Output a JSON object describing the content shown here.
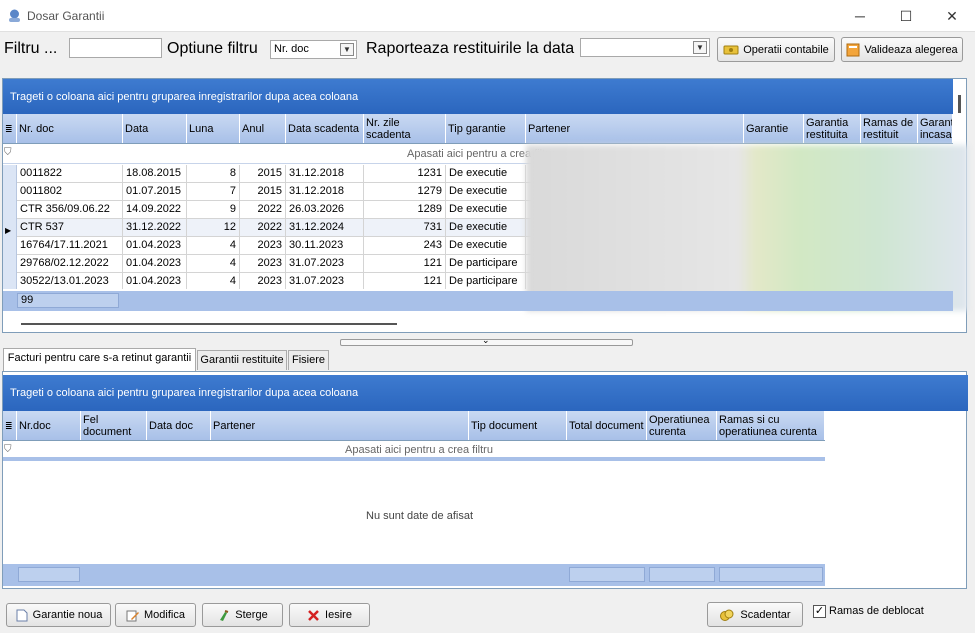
{
  "window": {
    "title": "Dosar Garantii",
    "min_glyph": "─",
    "max_glyph": "☐",
    "close_glyph": "✕"
  },
  "toolbar": {
    "filter_label": "Filtru ...",
    "filter_value": "",
    "option_label": "Optiune filtru",
    "option_value": "Nr. doc",
    "report_label": "Raporteaza restituirile la data",
    "report_value": "",
    "ops_button": "Operatii contabile",
    "validate_button": "Valideaza alegerea"
  },
  "grid1": {
    "group_text": "Trageti o coloana aici pentru gruparea inregistrarilor dupa acea coloana",
    "headers": [
      "Nr. doc",
      "Data",
      "Luna",
      "Anul",
      "Data scadenta",
      "Nr. zile scadenta",
      "Tip garantie",
      "Partener",
      "Garantie",
      "Garantia restituita",
      "Ramas de restituit",
      "Garantia incasata"
    ],
    "filter_text": "Apasati aici pentru a  crea filtru",
    "rows": [
      {
        "nr": "0011822",
        "data": "18.08.2015",
        "luna": "8",
        "anul": "2015",
        "scad": "31.12.2018",
        "zile": "1231",
        "tip": "De executie"
      },
      {
        "nr": "0011802",
        "data": "01.07.2015",
        "luna": "7",
        "anul": "2015",
        "scad": "31.12.2018",
        "zile": "1279",
        "tip": "De executie"
      },
      {
        "nr": "CTR 356/09.06.22",
        "data": "14.09.2022",
        "luna": "9",
        "anul": "2022",
        "scad": "26.03.2026",
        "zile": "1289",
        "tip": "De executie"
      },
      {
        "nr": "CTR 537",
        "data": "31.12.2022",
        "luna": "12",
        "anul": "2022",
        "scad": "31.12.2024",
        "zile": "731",
        "tip": "De executie"
      },
      {
        "nr": "16764/17.11.2021",
        "data": "01.04.2023",
        "luna": "4",
        "anul": "2023",
        "scad": "30.11.2023",
        "zile": "243",
        "tip": "De executie"
      },
      {
        "nr": "29768/02.12.2022",
        "data": "01.04.2023",
        "luna": "4",
        "anul": "2023",
        "scad": "31.07.2023",
        "zile": "121",
        "tip": "De participare"
      },
      {
        "nr": "30522/13.01.2023",
        "data": "01.04.2023",
        "luna": "4",
        "anul": "2023",
        "scad": "31.07.2023",
        "zile": "121",
        "tip": "De participare"
      }
    ],
    "footer_count": "99"
  },
  "tabs": [
    "Facturi pentru care s-a retinut garantii",
    "Garantii restituite",
    "Fisiere"
  ],
  "grid2": {
    "group_text": "Trageti o coloana aici pentru gruparea inregistrarilor dupa acea coloana",
    "headers": [
      "Nr.doc",
      "Fel document",
      "Data doc",
      "Partener",
      "Tip document",
      "Total document",
      "Operatiunea curenta",
      "Ramas si cu operatiunea curenta"
    ],
    "filter_text": "Apasati aici pentru a  crea filtru",
    "empty_text": "Nu sunt date de afisat"
  },
  "bottom": {
    "new_button": "Garantie noua",
    "edit_button": "Modifica",
    "delete_button": "Sterge",
    "exit_button": "Iesire",
    "schedule_button": "Scadentar",
    "unlock_label": "Ramas de deblocat",
    "unlock_checked": true
  },
  "colors": {
    "accent": "#2b66be",
    "header": "#a8c0e8"
  }
}
